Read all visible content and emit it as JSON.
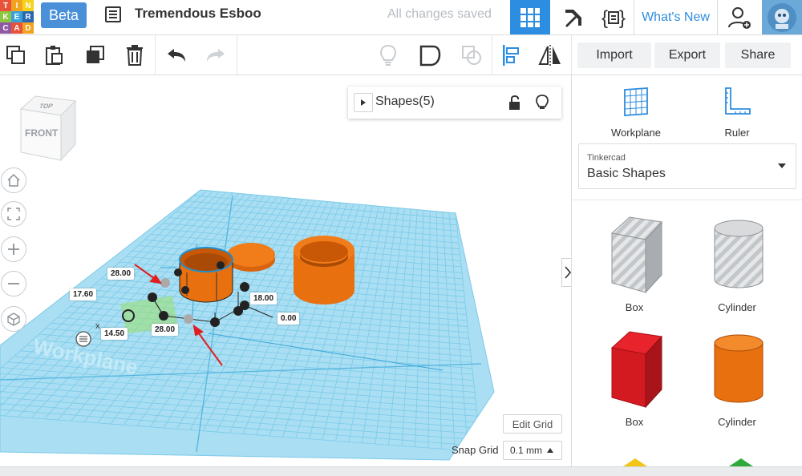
{
  "app": {
    "logo_letters": [
      "T",
      "I",
      "N",
      "K",
      "E",
      "R",
      "C",
      "A",
      "D"
    ],
    "logo_colors": [
      "#e8523b",
      "#f2a21c",
      "#f7d21c",
      "#8dc63f",
      "#38a2d9",
      "#2a66b1",
      "#8e58a3",
      "#e8523b",
      "#f2a21c"
    ],
    "beta_label": "Beta",
    "document_title": "Tremendous Esboo",
    "save_status": "All changes saved",
    "whats_new_label": "What's New",
    "accent_color": "#2d8de0"
  },
  "toolbar": {
    "import_label": "Import",
    "export_label": "Export",
    "share_label": "Share"
  },
  "viewport": {
    "viewcube_top": "TOP",
    "viewcube_front": "FRONT",
    "workplane_watermark": "Workplane",
    "shapes_panel": {
      "title": "Shapes(5)"
    },
    "dimensions": {
      "length_top": "28.00",
      "width_left": "17.60",
      "height_right": "18.00",
      "elevation": "0.00",
      "offset_x": "14.50",
      "length_bottom": "28.00",
      "axis_x": "x"
    },
    "edit_grid_label": "Edit Grid",
    "snap_grid_label": "Snap Grid",
    "snap_grid_value": "0.1 mm",
    "grid_color": "#8fd3ee",
    "shape_color": "#f07c1a"
  },
  "sidepanel": {
    "workplane_label": "Workplane",
    "ruler_label": "Ruler",
    "library_brand": "Tinkercad",
    "library_name": "Basic Shapes",
    "shapes": [
      {
        "label": "Box",
        "icon": "box-striped-icon"
      },
      {
        "label": "Cylinder",
        "icon": "cylinder-striped-icon"
      },
      {
        "label": "Box",
        "icon": "box-red-icon"
      },
      {
        "label": "Cylinder",
        "icon": "cylinder-orange-icon"
      }
    ]
  }
}
